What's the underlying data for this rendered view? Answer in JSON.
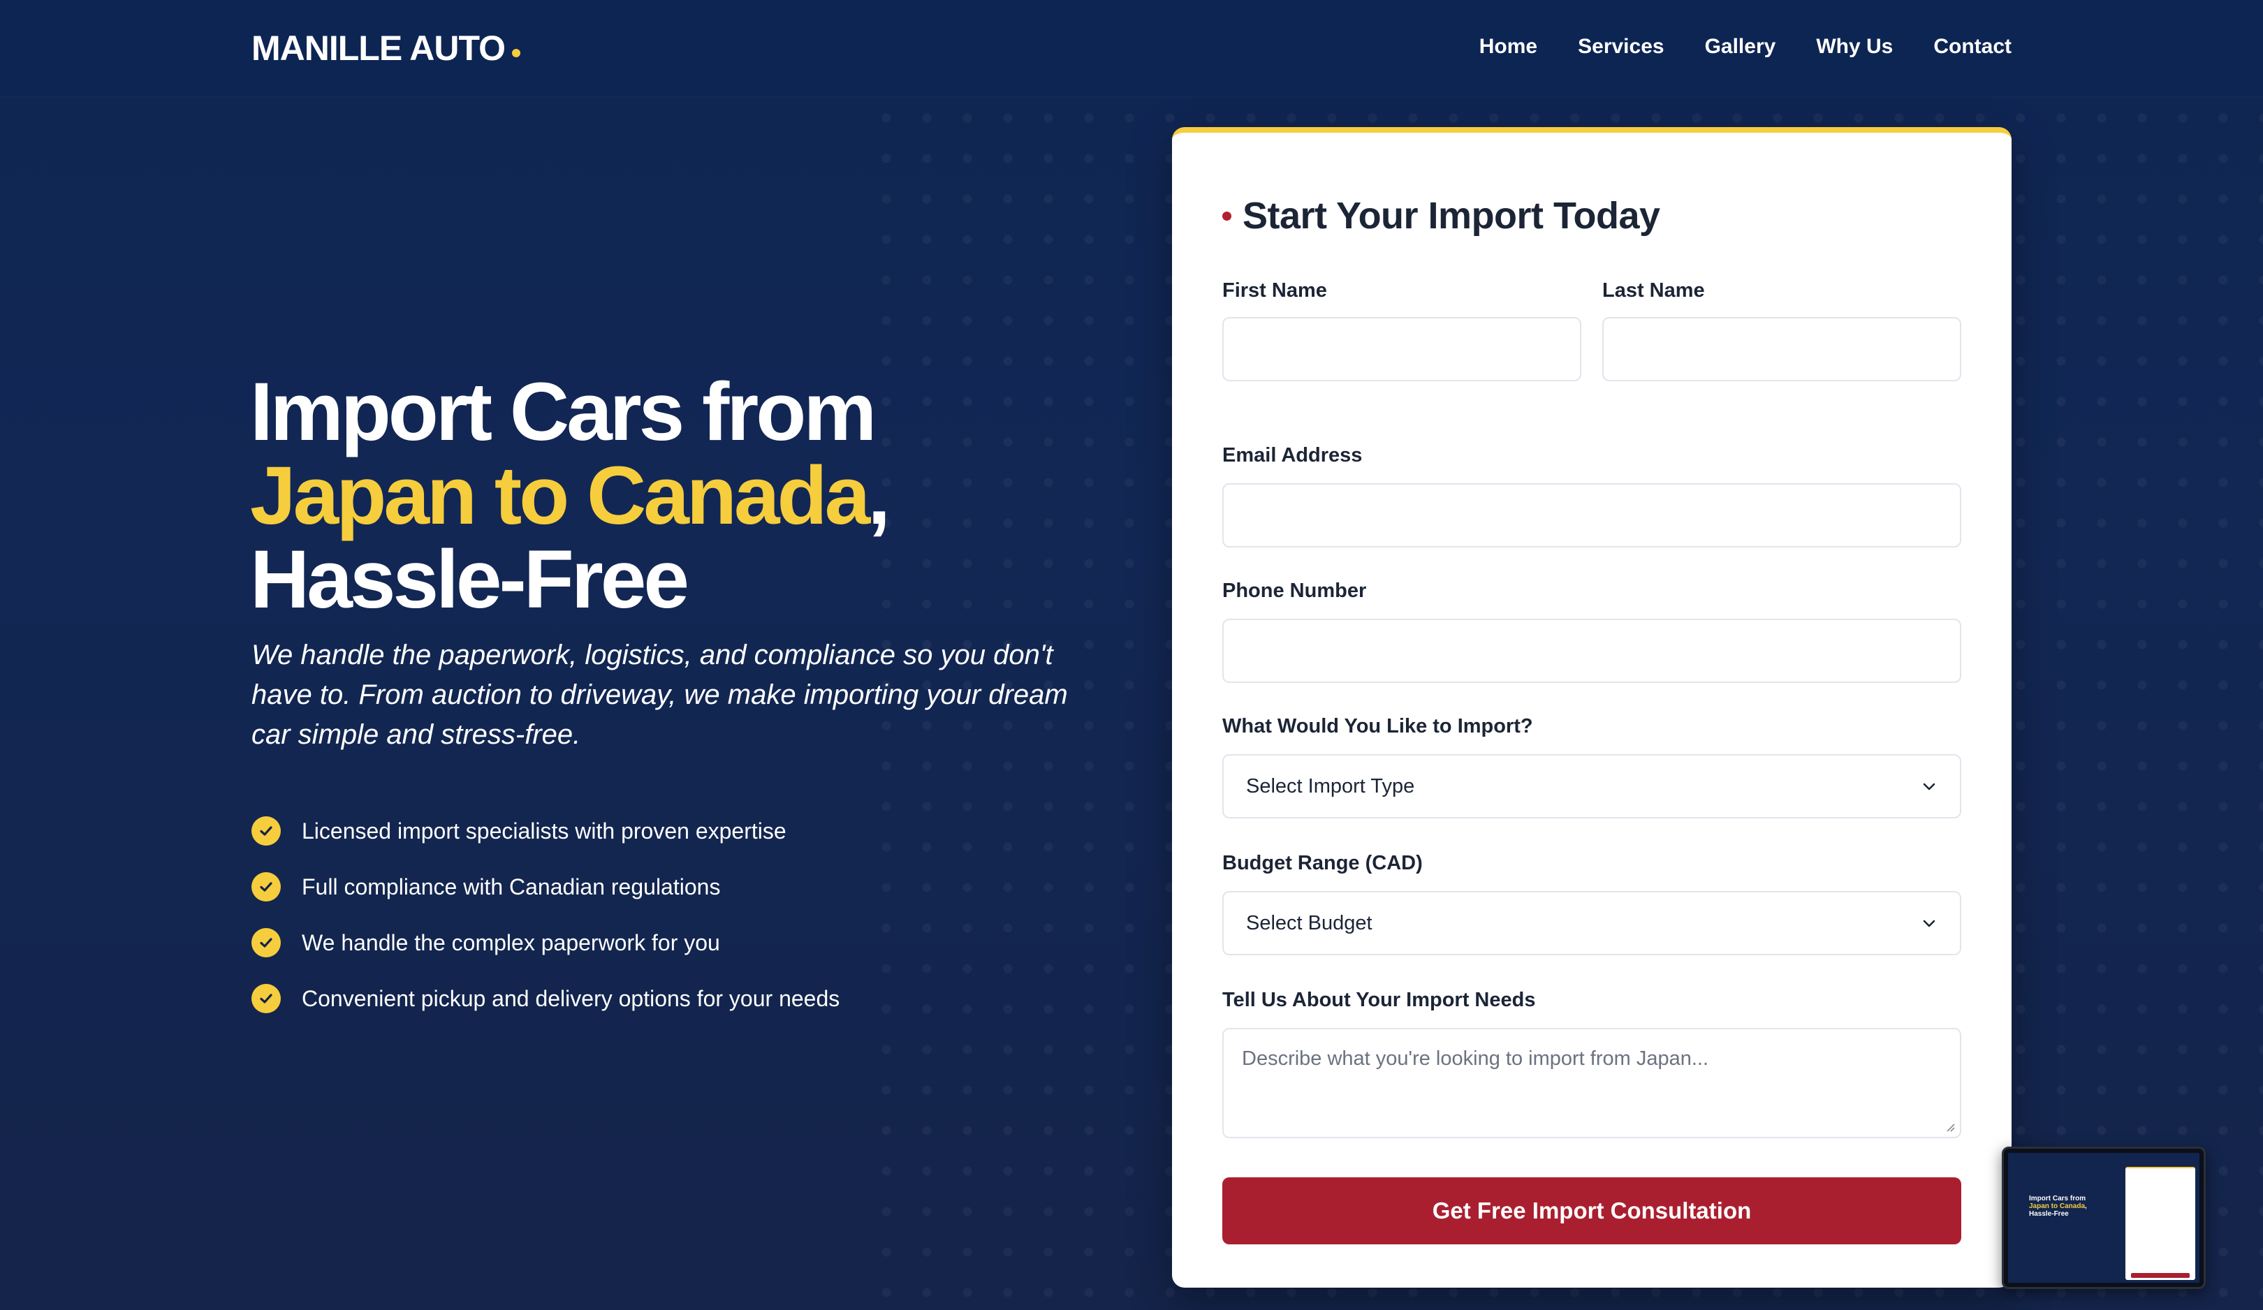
{
  "nav": {
    "brand": "MANILLE AUTO",
    "links": [
      "Home",
      "Services",
      "Gallery",
      "Why Us",
      "Contact"
    ]
  },
  "hero": {
    "headline_line1": "Import Cars from",
    "headline_highlight": "Japan to Canada",
    "headline_comma": ",",
    "headline_line3": "Hassle-Free",
    "subtitle": "We handle the paperwork, logistics, and compliance so you don't have to. From auction to driveway, we make importing your dream car simple and stress-free.",
    "features": [
      "Licensed import specialists with proven expertise",
      "Full compliance with Canadian regulations",
      "We handle the complex paperwork for you",
      "Convenient pickup and delivery options for your needs"
    ]
  },
  "form": {
    "title": "Start Your Import Today",
    "first_name_label": "First Name",
    "first_name_value": "",
    "last_name_label": "Last Name",
    "last_name_value": "",
    "email_label": "Email Address",
    "email_value": "",
    "phone_label": "Phone Number",
    "phone_value": "",
    "import_type_label": "What Would You Like to Import?",
    "import_type_selected": "Select Import Type",
    "budget_label": "Budget Range (CAD)",
    "budget_selected": "Select Budget",
    "needs_label": "Tell Us About Your Import Needs",
    "needs_placeholder": "Describe what you're looking to import from Japan...",
    "submit_label": "Get Free Import Consultation"
  },
  "colors": {
    "navy": "#0d2552",
    "accent_yellow": "#f6cd3c",
    "button_red": "#aa1f2f"
  },
  "icons": {
    "feature_bullet": "check-circle-icon",
    "select_arrow": "chevron-down-icon"
  }
}
